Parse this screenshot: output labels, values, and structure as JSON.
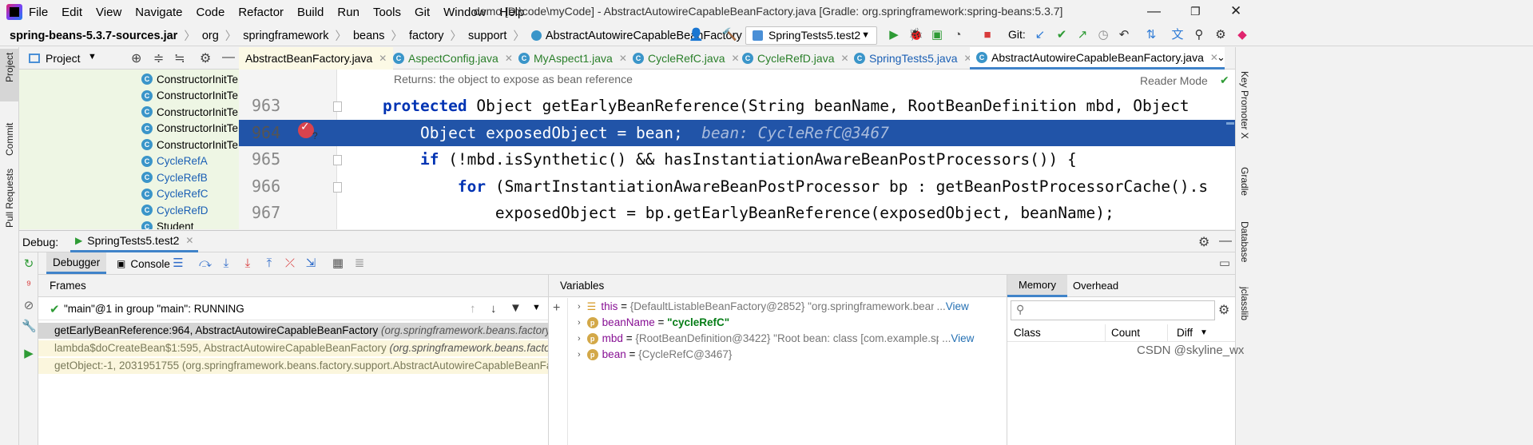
{
  "menubar": {
    "items": [
      "File",
      "Edit",
      "View",
      "Navigate",
      "Code",
      "Refactor",
      "Build",
      "Run",
      "Tools",
      "Git",
      "Window",
      "Help"
    ],
    "title": "demo [D:\\code\\myCode] - AbstractAutowireCapableBeanFactory.java [Gradle: org.springframework:spring-beans:5.3.7]"
  },
  "navbar": {
    "crumbs": [
      "spring-beans-5.3.7-sources.jar",
      "org",
      "springframework",
      "beans",
      "factory",
      "support",
      "AbstractAutowireCapableBeanFactory"
    ],
    "run_config": "SpringTests5.test2",
    "git_label": "Git:"
  },
  "leftstrip": {
    "project": "Project",
    "commit": "Commit",
    "pull_requests": "Pull Requests"
  },
  "rightstrip": {
    "key_promoter": "Key Promoter X",
    "gradle": "Gradle",
    "database": "Database",
    "jclasslib": "jclasslib"
  },
  "project": {
    "title": "Project",
    "items": [
      {
        "label": "ConstructorInitTe",
        "blue": false
      },
      {
        "label": "ConstructorInitTe",
        "blue": false
      },
      {
        "label": "ConstructorInitTe",
        "blue": false
      },
      {
        "label": "ConstructorInitTe",
        "blue": false
      },
      {
        "label": "ConstructorInitTe",
        "blue": false
      },
      {
        "label": "CycleRefA",
        "blue": true
      },
      {
        "label": "CycleRefB",
        "blue": true
      },
      {
        "label": "CycleRefC",
        "blue": true
      },
      {
        "label": "CycleRefD",
        "blue": true
      },
      {
        "label": "Student",
        "blue": false
      }
    ]
  },
  "tabs": [
    {
      "label": "AbstractBeanFactory.java"
    },
    {
      "label": "AspectConfig.java"
    },
    {
      "label": "MyAspect1.java"
    },
    {
      "label": "CycleRefC.java"
    },
    {
      "label": "CycleRefD.java"
    },
    {
      "label": "SpringTests5.java"
    },
    {
      "label": "AbstractAutowireCapableBeanFactory.java"
    }
  ],
  "editor": {
    "doc_hint": "Returns: the object to expose as bean reference",
    "reader_mode": "Reader Mode",
    "lines": [
      {
        "num": "963",
        "kw": "protected",
        "rest": " Object getEarlyBeanReference(String beanName, RootBeanDefinition mbd, Object "
      },
      {
        "num": "964",
        "code": "    Object exposedObject = bean;",
        "inline": "bean: CycleRefC@3467"
      },
      {
        "num": "965",
        "kw": "    if",
        "rest": " (!mbd.isSynthetic() && hasInstantiationAwareBeanPostProcessors()) {"
      },
      {
        "num": "966",
        "kw": "        for",
        "rest": " (SmartInstantiationAwareBeanPostProcessor bp : getBeanPostProcessorCache().s"
      },
      {
        "num": "967",
        "code": "            exposedObject = bp.getEarlyBeanReference(exposedObject, beanName);"
      }
    ]
  },
  "debug": {
    "label": "Debug:",
    "session": "SpringTests5.test2",
    "debugger_tab": "Debugger",
    "console_tab": "Console",
    "frames_title": "Frames",
    "thread": "\"main\"@1 in group \"main\": RUNNING",
    "frames": [
      {
        "method": "getEarlyBeanReference:964, AbstractAutowireCapableBeanFactory",
        "pkg": "(org.springframework.beans.factory."
      },
      {
        "method": "lambda$doCreateBean$1:595, AbstractAutowireCapableBeanFactory",
        "pkg": "(org.springframework.beans.factor"
      },
      {
        "method": "getObject:-1, 2031951755 (org.springframework.beans.factory.support.AbstractAutowireCapableBeanFa",
        "pkg": ""
      }
    ],
    "variables_title": "Variables",
    "variables": [
      {
        "name": "this",
        "value": "{DefaultListableBeanFactory@2852} \"org.springframework.beans.factory.",
        "link": "View"
      },
      {
        "name": "beanName",
        "value": "\"cycleRefC\"",
        "link": ""
      },
      {
        "name": "mbd",
        "value": "{RootBeanDefinition@3422} \"Root bean: class [com.example.spring.be",
        "link": "View"
      },
      {
        "name": "bean",
        "value": "{CycleRefC@3467}",
        "link": ""
      }
    ],
    "memory_tab": "Memory",
    "overhead_tab": "Overhead",
    "memory_cols": [
      "Class",
      "Count",
      "Diff"
    ]
  },
  "watermark": "CSDN @skyline_wx"
}
